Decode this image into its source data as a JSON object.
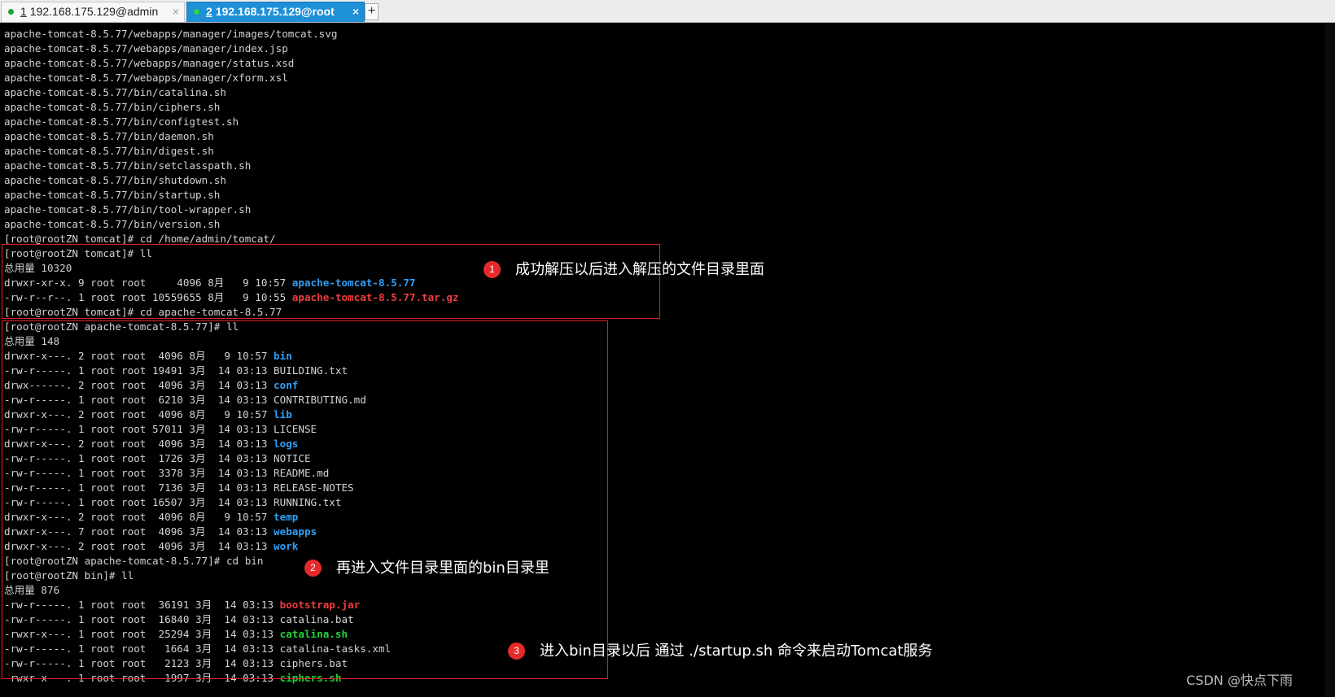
{
  "tabs": [
    {
      "number": "1",
      "title": "192.168.175.129@admin",
      "dot_color": "#1ea53a",
      "close": "×"
    },
    {
      "number": "2",
      "title": "192.168.175.129@root",
      "dot_color": "#2fd24a",
      "close": "×"
    }
  ],
  "new_tab_label": "+",
  "terminal": {
    "files": [
      "apache-tomcat-8.5.77/webapps/manager/images/tomcat.svg",
      "apache-tomcat-8.5.77/webapps/manager/index.jsp",
      "apache-tomcat-8.5.77/webapps/manager/status.xsd",
      "apache-tomcat-8.5.77/webapps/manager/xform.xsl",
      "apache-tomcat-8.5.77/bin/catalina.sh",
      "apache-tomcat-8.5.77/bin/ciphers.sh",
      "apache-tomcat-8.5.77/bin/configtest.sh",
      "apache-tomcat-8.5.77/bin/daemon.sh",
      "apache-tomcat-8.5.77/bin/digest.sh",
      "apache-tomcat-8.5.77/bin/setclasspath.sh",
      "apache-tomcat-8.5.77/bin/shutdown.sh",
      "apache-tomcat-8.5.77/bin/startup.sh",
      "apache-tomcat-8.5.77/bin/tool-wrapper.sh",
      "apache-tomcat-8.5.77/bin/version.sh"
    ],
    "cmd_cd_tomcat": "[root@rootZN tomcat]# cd /home/admin/tomcat/",
    "cmd_ll_1": "[root@rootZN tomcat]# ll",
    "total_1": "总用量 10320",
    "listing_1": [
      {
        "meta": "drwxr-xr-x. 9 root root     4096 8月   9 10:57 ",
        "name": "apache-tomcat-8.5.77",
        "kind": "dir"
      },
      {
        "meta": "-rw-r--r--. 1 root root 10559655 8月   9 10:55 ",
        "name": "apache-tomcat-8.5.77.tar.gz",
        "kind": "arc"
      }
    ],
    "cmd_cd_apache": "[root@rootZN tomcat]# cd apache-tomcat-8.5.77",
    "cmd_ll_2": "[root@rootZN apache-tomcat-8.5.77]# ll",
    "total_2": "总用量 148",
    "listing_2": [
      {
        "meta": "drwxr-x---. 2 root root  4096 8月   9 10:57 ",
        "name": "bin",
        "kind": "dir"
      },
      {
        "meta": "-rw-r-----. 1 root root 19491 3月  14 03:13 ",
        "name": "BUILDING.txt",
        "kind": "file"
      },
      {
        "meta": "drwx------. 2 root root  4096 3月  14 03:13 ",
        "name": "conf",
        "kind": "dir"
      },
      {
        "meta": "-rw-r-----. 1 root root  6210 3月  14 03:13 ",
        "name": "CONTRIBUTING.md",
        "kind": "file"
      },
      {
        "meta": "drwxr-x---. 2 root root  4096 8月   9 10:57 ",
        "name": "lib",
        "kind": "dir"
      },
      {
        "meta": "-rw-r-----. 1 root root 57011 3月  14 03:13 ",
        "name": "LICENSE",
        "kind": "file"
      },
      {
        "meta": "drwxr-x---. 2 root root  4096 3月  14 03:13 ",
        "name": "logs",
        "kind": "dir"
      },
      {
        "meta": "-rw-r-----. 1 root root  1726 3月  14 03:13 ",
        "name": "NOTICE",
        "kind": "file"
      },
      {
        "meta": "-rw-r-----. 1 root root  3378 3月  14 03:13 ",
        "name": "README.md",
        "kind": "file"
      },
      {
        "meta": "-rw-r-----. 1 root root  7136 3月  14 03:13 ",
        "name": "RELEASE-NOTES",
        "kind": "file"
      },
      {
        "meta": "-rw-r-----. 1 root root 16507 3月  14 03:13 ",
        "name": "RUNNING.txt",
        "kind": "file"
      },
      {
        "meta": "drwxr-x---. 2 root root  4096 8月   9 10:57 ",
        "name": "temp",
        "kind": "dir"
      },
      {
        "meta": "drwxr-x---. 7 root root  4096 3月  14 03:13 ",
        "name": "webapps",
        "kind": "dir"
      },
      {
        "meta": "drwxr-x---. 2 root root  4096 3月  14 03:13 ",
        "name": "work",
        "kind": "dir"
      }
    ],
    "cmd_cd_bin": "[root@rootZN apache-tomcat-8.5.77]# cd bin",
    "cmd_ll_3": "[root@rootZN bin]# ll",
    "total_3": "总用量 876",
    "listing_3": [
      {
        "meta": "-rw-r-----. 1 root root  36191 3月  14 03:13 ",
        "name": "bootstrap.jar",
        "kind": "arc"
      },
      {
        "meta": "-rw-r-----. 1 root root  16840 3月  14 03:13 ",
        "name": "catalina.bat",
        "kind": "file"
      },
      {
        "meta": "-rwxr-x---. 1 root root  25294 3月  14 03:13 ",
        "name": "catalina.sh",
        "kind": "exe"
      },
      {
        "meta": "-rw-r-----. 1 root root   1664 3月  14 03:13 ",
        "name": "catalina-tasks.xml",
        "kind": "file"
      },
      {
        "meta": "-rw-r-----. 1 root root   2123 3月  14 03:13 ",
        "name": "ciphers.bat",
        "kind": "file"
      },
      {
        "meta": "-rwxr-x---. 1 root root   1997 3月  14 03:13 ",
        "name": "ciphers.sh",
        "kind": "exe"
      }
    ]
  },
  "annotations": [
    {
      "badge": "1",
      "text": "成功解压以后进入解压的文件目录里面"
    },
    {
      "badge": "2",
      "text": "再进入文件目录里面的bin目录里"
    },
    {
      "badge": "3",
      "text": "进入bin目录以后  通过 ./startup.sh  命令来启动Tomcat服务"
    }
  ],
  "watermark": "CSDN @快点下雨",
  "colors": {
    "dir": "#2e9ff6",
    "archive": "#ee3c3c",
    "executable": "#21d13b",
    "annotation_box": "#e02020"
  }
}
